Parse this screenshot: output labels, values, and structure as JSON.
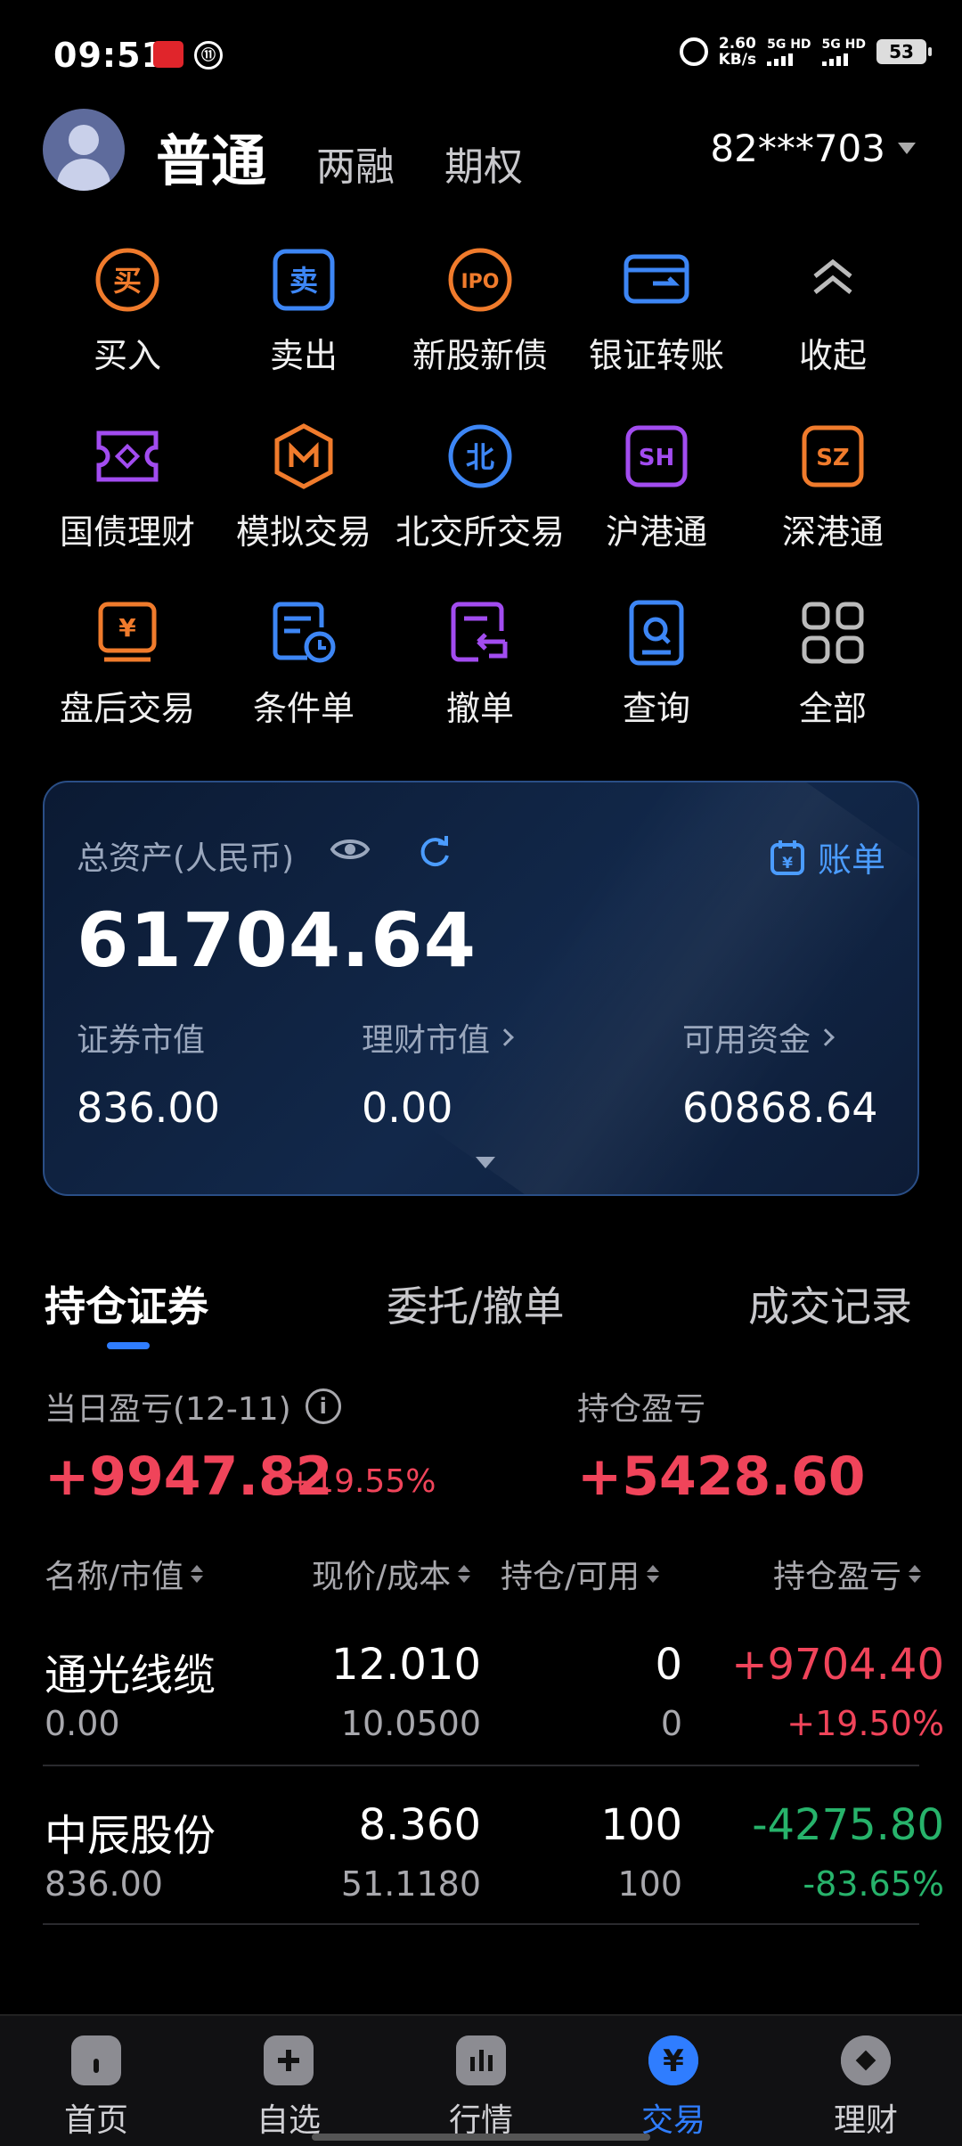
{
  "status_bar": {
    "time": "09:51",
    "net_speed_value": "2.60",
    "net_speed_unit": "KB/s",
    "sim1": "5G HD",
    "sim2": "5G HD",
    "battery": "53",
    "app_badge2": "⑪"
  },
  "header": {
    "tabs": [
      {
        "label": "普通",
        "active": true
      },
      {
        "label": "两融",
        "active": false
      },
      {
        "label": "期权",
        "active": false
      }
    ],
    "account_no": "82***703"
  },
  "menu": {
    "rows": [
      [
        {
          "label": "买入",
          "icon": "buy-icon",
          "glyph": "买",
          "color": "#f07b2c"
        },
        {
          "label": "卖出",
          "icon": "sell-icon",
          "glyph": "卖",
          "color": "#3d86f5"
        },
        {
          "label": "新股新债",
          "icon": "ipo-icon",
          "glyph": "IPO",
          "color": "#f07b2c"
        },
        {
          "label": "银证转账",
          "icon": "bank-transfer-icon",
          "glyph": "",
          "color": "#3d86f5"
        },
        {
          "label": "收起",
          "icon": "collapse-icon",
          "glyph": "",
          "color": "#bbbbbb"
        }
      ],
      [
        {
          "label": "国债理财",
          "icon": "bond-icon",
          "glyph": "",
          "color": "#a24cf0"
        },
        {
          "label": "模拟交易",
          "icon": "simulated-trade-icon",
          "glyph": "M",
          "color": "#f07b2c"
        },
        {
          "label": "北交所交易",
          "icon": "bse-icon",
          "glyph": "北",
          "color": "#3d86f5"
        },
        {
          "label": "沪港通",
          "icon": "sh-hk-connect-icon",
          "glyph": "SH",
          "color": "#a24cf0"
        },
        {
          "label": "深港通",
          "icon": "sz-hk-connect-icon",
          "glyph": "SZ",
          "color": "#f07b2c"
        }
      ],
      [
        {
          "label": "盘后交易",
          "icon": "after-hours-icon",
          "glyph": "¥",
          "color": "#f07b2c"
        },
        {
          "label": "条件单",
          "icon": "conditional-order-icon",
          "glyph": "",
          "color": "#3d86f5"
        },
        {
          "label": "撤单",
          "icon": "cancel-order-icon",
          "glyph": "",
          "color": "#a24cf0"
        },
        {
          "label": "查询",
          "icon": "query-icon",
          "glyph": "",
          "color": "#3d86f5"
        },
        {
          "label": "全部",
          "icon": "all-icon",
          "glyph": "",
          "color": "#bbbbbb"
        }
      ]
    ]
  },
  "assets": {
    "total_label": "总资产(人民币)",
    "bill_label": "账单",
    "total_value": "61704.64",
    "securities_label": "证券市值",
    "securities_value": "836.00",
    "wealth_label": "理财市值",
    "wealth_value": "0.00",
    "available_label": "可用资金",
    "available_value": "60868.64",
    "accent": "#4b9cff"
  },
  "position_tabs": [
    {
      "label": "持仓证券",
      "active": true
    },
    {
      "label": "委托/撤单",
      "active": false
    },
    {
      "label": "成交记录",
      "active": false
    }
  ],
  "pnl": {
    "daily_label": "当日盈亏(12-11)",
    "daily_value": "+9947.82",
    "daily_pct": "+19.55%",
    "holding_label": "持仓盈亏",
    "holding_value": "+5428.60",
    "up_color": "#f0445a",
    "down_color": "#27b36b"
  },
  "table": {
    "headers": [
      "名称/市值",
      "现价/成本",
      "持仓/可用",
      "持仓盈亏"
    ],
    "rows": [
      {
        "name": "通光线缆",
        "market_value": "0.00",
        "price": "12.010",
        "cost": "10.0500",
        "position": "0",
        "available": "0",
        "pnl": "+9704.40",
        "pnl_pct": "+19.50%",
        "direction": "up"
      },
      {
        "name": "中辰股份",
        "market_value": "836.00",
        "price": "8.360",
        "cost": "51.1180",
        "position": "100",
        "available": "100",
        "pnl": "-4275.80",
        "pnl_pct": "-83.65%",
        "direction": "down"
      }
    ]
  },
  "bottom_nav": [
    {
      "label": "首页",
      "icon": "home-icon",
      "active": false
    },
    {
      "label": "自选",
      "icon": "watchlist-icon",
      "active": false
    },
    {
      "label": "行情",
      "icon": "market-icon",
      "active": false
    },
    {
      "label": "交易",
      "icon": "trade-icon",
      "active": true
    },
    {
      "label": "理财",
      "icon": "wealth-icon",
      "active": false
    }
  ]
}
